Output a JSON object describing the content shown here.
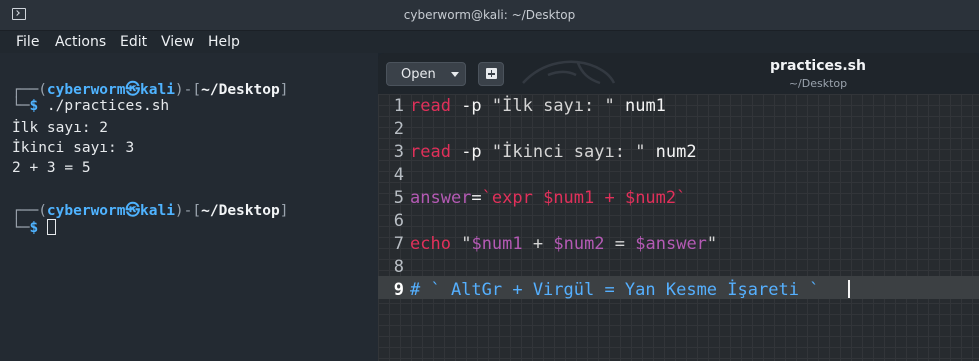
{
  "window": {
    "title": "cyberworm@kali: ~/Desktop"
  },
  "menu": {
    "items": [
      "File",
      "Actions",
      "Edit",
      "View",
      "Help"
    ]
  },
  "terminal": {
    "prompt1": {
      "top_open": "┌──(",
      "user": "cyberworm",
      "at_glyph": "㉿",
      "host": "kali",
      "mid": ")-[",
      "path": "~/Desktop",
      "top_close": "]",
      "bottom": "└─",
      "dollar": "$",
      "command": " ./practices.sh"
    },
    "output": [
      "İlk sayı: 2",
      "İkinci sayı: 3",
      "2 + 3 = 5"
    ],
    "prompt2": {
      "top_open": "┌──(",
      "user": "cyberworm",
      "at_glyph": "㉿",
      "host": "kali",
      "mid": ")-[",
      "path": "~/Desktop",
      "top_close": "]",
      "bottom": "└─",
      "dollar": "$"
    }
  },
  "editor": {
    "open_label": "Open",
    "doc_title": "practices.sh",
    "doc_subtitle": "~/Desktop",
    "current_line": 9,
    "line_numbers": [
      "1",
      "2",
      "3",
      "4",
      "5",
      "6",
      "7",
      "8",
      "9"
    ],
    "lines": {
      "l1": {
        "kw": "read",
        "flag": " -p ",
        "str": "\"İlk sayı: \"",
        "var": " num1"
      },
      "l3": {
        "kw": "read",
        "flag": " -p ",
        "str": "\"İkinci sayı: \"",
        "var": " num2"
      },
      "l5": {
        "name": "answer",
        "eq": "=",
        "expr": "`expr $num1 + $num2`"
      },
      "l7": {
        "kw": "echo",
        "sp": " ",
        "str_open": "\"",
        "v1": "$num1",
        "plus": " + ",
        "v2": "$num2",
        "eqs": " = ",
        "v3": "$answer",
        "str_close": "\""
      },
      "l9": {
        "comment": "# ` AltGr + Virgül = Yan Kesme İşareti `"
      }
    },
    "colors": {
      "keyword": "#e0305a",
      "variable": "#b45ab4",
      "comment": "#55b0ff",
      "string": "#d5d5d5"
    }
  }
}
